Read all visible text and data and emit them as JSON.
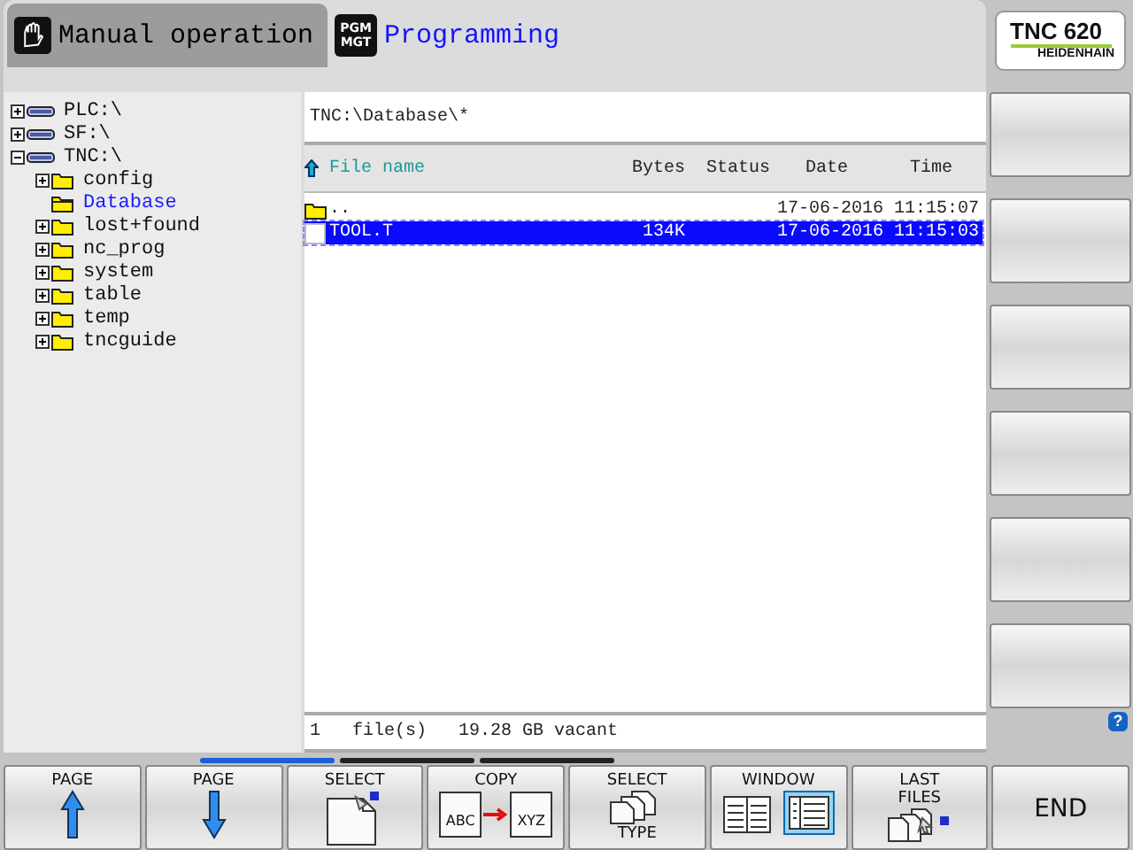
{
  "mode_tabs": [
    {
      "label": "Manual operation",
      "kind": "manual",
      "selected": false
    },
    {
      "label": "Programming",
      "kind": "program",
      "icon_lines": [
        "PGM",
        "MGT"
      ],
      "selected": true
    }
  ],
  "logo": {
    "model": "TNC 620",
    "brand": "HEIDENHAIN"
  },
  "tree": [
    {
      "label": "PLC:\\",
      "kind": "drive",
      "expanded": false,
      "selected": false
    },
    {
      "label": "SF:\\",
      "kind": "drive",
      "expanded": false,
      "selected": false
    },
    {
      "label": "TNC:\\",
      "kind": "drive",
      "expanded": true,
      "selected": false,
      "children": [
        {
          "label": "config",
          "kind": "folder",
          "expanded": false,
          "selected": false
        },
        {
          "label": "Database",
          "kind": "folder",
          "selected": true
        },
        {
          "label": "lost+found",
          "kind": "folder",
          "expanded": false,
          "selected": false
        },
        {
          "label": "nc_prog",
          "kind": "folder",
          "expanded": false,
          "selected": false
        },
        {
          "label": "system",
          "kind": "folder",
          "expanded": false,
          "selected": false
        },
        {
          "label": "table",
          "kind": "folder",
          "expanded": false,
          "selected": false
        },
        {
          "label": "temp",
          "kind": "folder",
          "expanded": false,
          "selected": false
        },
        {
          "label": "tncguide",
          "kind": "folder",
          "expanded": false,
          "selected": false
        }
      ]
    }
  ],
  "path": "TNC:\\Database\\*",
  "table": {
    "columns": [
      "File name",
      "Bytes",
      "Status",
      "Date",
      "Time"
    ],
    "rows": [
      {
        "kind": "folder",
        "name": "..",
        "bytes": "",
        "date": "17-06-2016",
        "time": "11:15:07",
        "selected": false
      },
      {
        "kind": "file",
        "name": "TOOL.T",
        "bytes": "134K",
        "date": "17-06-2016",
        "time": "11:15:03",
        "selected": true
      }
    ]
  },
  "status_bar": {
    "count": "1",
    "unit": "file(s)",
    "free": "19.28 GB vacant"
  },
  "softkey_pages": [
    {
      "selected": true
    },
    {
      "selected": false
    },
    {
      "selected": false
    }
  ],
  "help": "?",
  "softkeys": [
    {
      "top": "PAGE",
      "kind": "up"
    },
    {
      "top": "PAGE",
      "kind": "down"
    },
    {
      "top": "SELECT",
      "kind": "select"
    },
    {
      "top": "COPY",
      "kind": "copy",
      "icon_texts": [
        "ABC",
        "XYZ"
      ]
    },
    {
      "top": "SELECT",
      "kind": "type",
      "bottom": "TYPE"
    },
    {
      "top": "WINDOW",
      "kind": "window"
    },
    {
      "top": "LAST FILES",
      "kind": "recent"
    },
    {
      "top": "END",
      "kind": "plain"
    }
  ]
}
